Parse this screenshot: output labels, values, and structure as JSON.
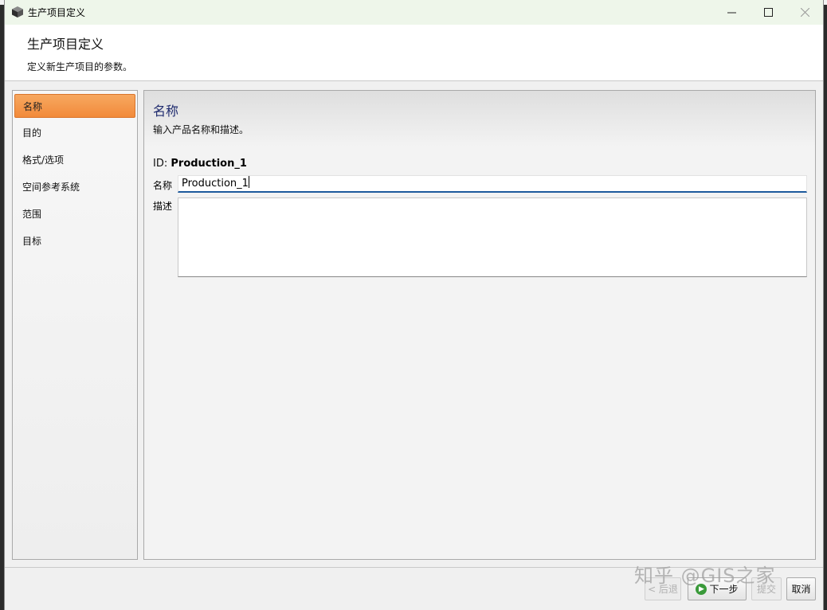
{
  "window": {
    "title": "生产项目定义",
    "buttons": {
      "minimize": "—",
      "maximize": "☐",
      "close": "✕"
    }
  },
  "header": {
    "title": "生产项目定义",
    "description": "定义新生产项目的参数。"
  },
  "nav": {
    "items": [
      {
        "label": "名称",
        "active": true
      },
      {
        "label": "目的"
      },
      {
        "label": "格式/选项"
      },
      {
        "label": "空间参考系统"
      },
      {
        "label": "范围"
      },
      {
        "label": "目标"
      }
    ]
  },
  "content": {
    "title": "名称",
    "subtitle": "输入产品名称和描述。",
    "id_label": "ID:",
    "id_value": "Production_1",
    "name_label": "名称",
    "name_value": "Production_1",
    "desc_label": "描述",
    "desc_value": ""
  },
  "footer": {
    "back_label": "< 后退",
    "next_label": "下一步",
    "submit_label": "提交",
    "cancel_label": "取消"
  },
  "watermark": "知乎 @GIS之家",
  "colors": {
    "accent_active": "#f28a3a",
    "title_blue": "#1e2a6e",
    "input_focus": "#1d5a9c"
  }
}
